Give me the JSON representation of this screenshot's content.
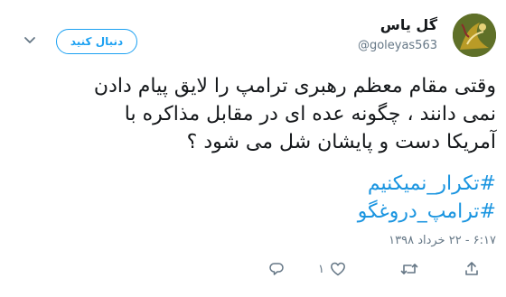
{
  "user": {
    "name": "گل یاس",
    "handle": "@goleyas563"
  },
  "follow_label": "دنبال کنید",
  "tweet": {
    "lines": [
      "وقتی مقام معظم رهبری ترامپ را لایق پیام دادن",
      "نمی دانند ، چگونه عده ای در مقابل مذاکره با",
      "آمریکا دست و پایشان شل می شود ؟"
    ],
    "hashtags": [
      "#تکرار_نمیکنیم",
      "#ترامپ_دروغگو"
    ]
  },
  "timestamp": "۶:۱۷ - ۲۲ خرداد ۱۳۹۸",
  "actions": {
    "like_count": "۱"
  },
  "colors": {
    "accent": "#1da1f2",
    "hashtag": "#1b95e0",
    "muted": "#657786",
    "text": "#14171a"
  },
  "icons": {
    "caret": "chevron-down-icon",
    "reply": "reply-icon",
    "retweet": "retweet-icon",
    "like": "heart-icon",
    "share": "share-icon"
  }
}
